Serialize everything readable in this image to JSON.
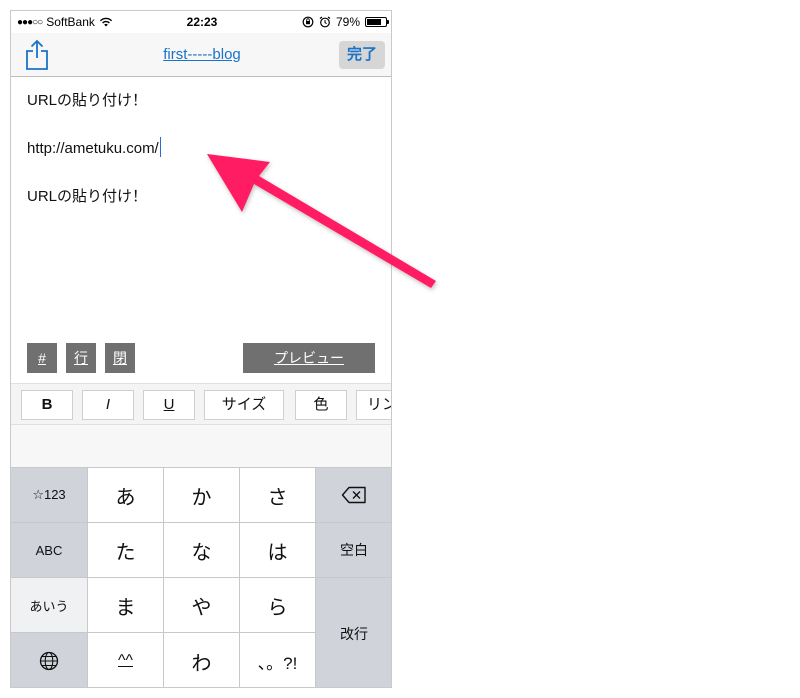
{
  "status_bar": {
    "signal": "●●●○○",
    "carrier": "SoftBank",
    "time": "22:23",
    "battery": "79%"
  },
  "nav": {
    "title": "first-----blog",
    "done_label": "完了"
  },
  "editor": {
    "line1": "URLの貼り付け！",
    "line2": "http://ametuku.com/",
    "line3": "URLの貼り付け！"
  },
  "tool_row": {
    "hash": "#",
    "row": "行",
    "open": "閉",
    "preview": "プレビュー"
  },
  "format_bar": {
    "bold": "B",
    "italic": "I",
    "underline": "U",
    "size": "サイズ",
    "color": "色",
    "link": "リン"
  },
  "keyboard": {
    "row1": [
      "☆123",
      "あ",
      "か",
      "さ"
    ],
    "row2": [
      "ABC",
      "た",
      "な",
      "は",
      "空白"
    ],
    "row3": [
      "あいう",
      "ま",
      "や",
      "ら"
    ],
    "row4": [
      "^^",
      "わ",
      "、。?!"
    ],
    "enter": "改行"
  },
  "annotation": {
    "arrow_color": "#ff1a63"
  }
}
